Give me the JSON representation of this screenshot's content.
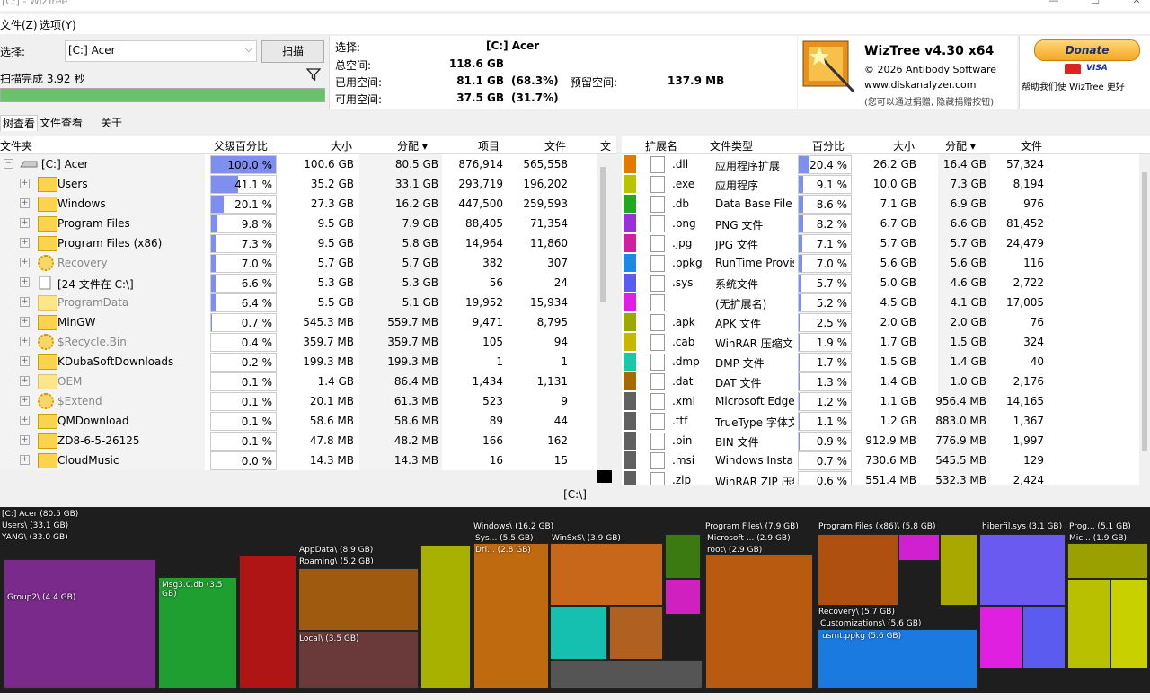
{
  "window": {
    "title": "[C:]  - WizTree"
  },
  "menu": {
    "file": "文件(Z)",
    "options": "选项(Y)"
  },
  "scan": {
    "select_label": "选择:",
    "drive_value": "[C:] Acer",
    "scan_button": "扫描",
    "status": "扫描完成 3.92 秒"
  },
  "drive_info": {
    "select_label": "选择:",
    "select_value": "[C:]  Acer",
    "total_label": "总空间:",
    "total_value": "118.6 GB",
    "used_label": "已用空间:",
    "used_value": "81.1 GB",
    "used_pct": "(68.3%)",
    "free_label": "可用空间:",
    "free_value": "37.5 GB",
    "free_pct": "(31.7%)",
    "reserved_label": "预留空间:",
    "reserved_value": "137.9 MB"
  },
  "about": {
    "product": "WizTree v4.30 x64",
    "copyright": "© 2026 Antibody Software",
    "url": "www.diskanalyzer.com",
    "hint": "(您可以通过捐赠, 隐藏捐赠按钮)"
  },
  "donate": {
    "button": "Donate",
    "visa": "VISA",
    "text": "帮助我们使 WizTree 更好"
  },
  "tabs": [
    "树查看",
    "文件查看",
    "关于"
  ],
  "tree": {
    "columns": [
      "文件夹",
      "父级百分比",
      "大小",
      "分配 ▾",
      "项目",
      "文件",
      "文"
    ],
    "rows": [
      {
        "name": "[C:] Acer",
        "pct": "100.0 %",
        "frac": 1.0,
        "size": "100.6 GB",
        "alloc": "80.5 GB",
        "items": "876,914",
        "files": "565,558",
        "icon": "drive",
        "dim": false
      },
      {
        "name": "Users",
        "pct": "41.1 %",
        "frac": 0.411,
        "size": "35.2 GB",
        "alloc": "33.1 GB",
        "items": "293,719",
        "files": "196,202",
        "icon": "folder",
        "dim": false
      },
      {
        "name": "Windows",
        "pct": "20.1 %",
        "frac": 0.201,
        "size": "27.3 GB",
        "alloc": "16.2 GB",
        "items": "447,500",
        "files": "259,593",
        "icon": "folder",
        "dim": false
      },
      {
        "name": "Program Files",
        "pct": "9.8 %",
        "frac": 0.098,
        "size": "9.5 GB",
        "alloc": "7.9 GB",
        "items": "88,405",
        "files": "71,354",
        "icon": "folder",
        "dim": false
      },
      {
        "name": "Program Files (x86)",
        "pct": "7.3 %",
        "frac": 0.073,
        "size": "9.5 GB",
        "alloc": "5.8 GB",
        "items": "14,964",
        "files": "11,860",
        "icon": "folder",
        "dim": false
      },
      {
        "name": "Recovery",
        "pct": "7.0 %",
        "frac": 0.07,
        "size": "5.7 GB",
        "alloc": "5.7 GB",
        "items": "382",
        "files": "307",
        "icon": "gear",
        "dim": true
      },
      {
        "name": "[24 文件在 C:\\]",
        "pct": "6.6 %",
        "frac": 0.066,
        "size": "5.3 GB",
        "alloc": "5.3 GB",
        "items": "56",
        "files": "24",
        "icon": "files",
        "dim": false
      },
      {
        "name": "ProgramData",
        "pct": "6.4 %",
        "frac": 0.064,
        "size": "5.5 GB",
        "alloc": "5.1 GB",
        "items": "19,952",
        "files": "15,934",
        "icon": "folder",
        "dim": true
      },
      {
        "name": "MinGW",
        "pct": "0.7 %",
        "frac": 0.007,
        "size": "545.3 MB",
        "alloc": "559.7 MB",
        "items": "9,471",
        "files": "8,795",
        "icon": "folder",
        "dim": false
      },
      {
        "name": "$Recycle.Bin",
        "pct": "0.4 %",
        "frac": 0.004,
        "size": "359.7 MB",
        "alloc": "359.7 MB",
        "items": "105",
        "files": "94",
        "icon": "gear",
        "dim": true
      },
      {
        "name": "KDubaSoftDownloads",
        "pct": "0.2 %",
        "frac": 0.002,
        "size": "199.3 MB",
        "alloc": "199.3 MB",
        "items": "1",
        "files": "1",
        "icon": "folder",
        "dim": false
      },
      {
        "name": "OEM",
        "pct": "0.1 %",
        "frac": 0.001,
        "size": "1.4 GB",
        "alloc": "86.4 MB",
        "items": "1,434",
        "files": "1,131",
        "icon": "folder",
        "dim": true
      },
      {
        "name": "$Extend",
        "pct": "0.1 %",
        "frac": 0.001,
        "size": "20.1 MB",
        "alloc": "61.3 MB",
        "items": "523",
        "files": "9",
        "icon": "gear",
        "dim": true
      },
      {
        "name": "QMDownload",
        "pct": "0.1 %",
        "frac": 0.001,
        "size": "58.6 MB",
        "alloc": "58.6 MB",
        "items": "89",
        "files": "44",
        "icon": "folder",
        "dim": false
      },
      {
        "name": "ZD8-6-5-26125",
        "pct": "0.1 %",
        "frac": 0.001,
        "size": "47.8 MB",
        "alloc": "48.2 MB",
        "items": "166",
        "files": "162",
        "icon": "folder",
        "dim": false
      },
      {
        "name": "CloudMusic",
        "pct": "0.0 %",
        "frac": 0.0,
        "size": "14.3 MB",
        "alloc": "14.3 MB",
        "items": "16",
        "files": "15",
        "icon": "folder",
        "dim": false
      }
    ]
  },
  "ext": {
    "columns": [
      "扩展名",
      "文件类型",
      "百分比",
      "大小",
      "分配 ▾",
      "文件"
    ],
    "rows": [
      {
        "ext": ".dll",
        "type": "应用程序扩展",
        "pct": "20.4 %",
        "frac": 0.204,
        "size": "26.2 GB",
        "alloc": "16.4 GB",
        "files": "57,324",
        "color": "#e07b00"
      },
      {
        "ext": ".exe",
        "type": "应用程序",
        "pct": "9.1 %",
        "frac": 0.091,
        "size": "10.0 GB",
        "alloc": "7.3 GB",
        "files": "8,194",
        "color": "#b8c400"
      },
      {
        "ext": ".db",
        "type": "Data Base File",
        "pct": "8.6 %",
        "frac": 0.086,
        "size": "7.1 GB",
        "alloc": "6.9 GB",
        "files": "976",
        "color": "#22a722"
      },
      {
        "ext": ".png",
        "type": "PNG 文件",
        "pct": "8.2 %",
        "frac": 0.082,
        "size": "6.7 GB",
        "alloc": "6.6 GB",
        "files": "81,452",
        "color": "#9b30d8"
      },
      {
        "ext": ".jpg",
        "type": "JPG 文件",
        "pct": "7.1 %",
        "frac": 0.071,
        "size": "5.7 GB",
        "alloc": "5.7 GB",
        "files": "24,479",
        "color": "#d0209f"
      },
      {
        "ext": ".ppkg",
        "type": "RunTime Provisi",
        "pct": "7.0 %",
        "frac": 0.07,
        "size": "5.6 GB",
        "alloc": "5.6 GB",
        "files": "116",
        "color": "#1e88e5"
      },
      {
        "ext": ".sys",
        "type": "系统文件",
        "pct": "5.7 %",
        "frac": 0.057,
        "size": "5.0 GB",
        "alloc": "4.6 GB",
        "files": "2,722",
        "color": "#5b5bf0"
      },
      {
        "ext": "",
        "type": "(无扩展名)",
        "pct": "5.2 %",
        "frac": 0.052,
        "size": "4.5 GB",
        "alloc": "4.1 GB",
        "files": "17,005",
        "color": "#e020e0"
      },
      {
        "ext": ".apk",
        "type": "APK 文件",
        "pct": "2.5 %",
        "frac": 0.025,
        "size": "2.0 GB",
        "alloc": "2.0 GB",
        "files": "76",
        "color": "#9aa800"
      },
      {
        "ext": ".cab",
        "type": "WinRAR 压缩文",
        "pct": "1.9 %",
        "frac": 0.019,
        "size": "1.7 GB",
        "alloc": "1.5 GB",
        "files": "324",
        "color": "#c6b800"
      },
      {
        "ext": ".dmp",
        "type": "DMP 文件",
        "pct": "1.7 %",
        "frac": 0.017,
        "size": "1.5 GB",
        "alloc": "1.4 GB",
        "files": "40",
        "color": "#18c8a8"
      },
      {
        "ext": ".dat",
        "type": "DAT 文件",
        "pct": "1.3 %",
        "frac": 0.013,
        "size": "1.4 GB",
        "alloc": "1.0 GB",
        "files": "2,176",
        "color": "#a86a00"
      },
      {
        "ext": ".xml",
        "type": "Microsoft Edge I",
        "pct": "1.2 %",
        "frac": 0.012,
        "size": "1.1 GB",
        "alloc": "956.4 MB",
        "files": "14,165",
        "color": "#606060"
      },
      {
        "ext": ".ttf",
        "type": "TrueType 字体文",
        "pct": "1.1 %",
        "frac": 0.011,
        "size": "1.2 GB",
        "alloc": "883.0 MB",
        "files": "1,367",
        "color": "#606060"
      },
      {
        "ext": ".bin",
        "type": "BIN 文件",
        "pct": "0.9 %",
        "frac": 0.009,
        "size": "912.9 MB",
        "alloc": "776.9 MB",
        "files": "1,997",
        "color": "#606060"
      },
      {
        "ext": ".msi",
        "type": "Windows Installe",
        "pct": "0.7 %",
        "frac": 0.007,
        "size": "730.6 MB",
        "alloc": "545.5 MB",
        "files": "129",
        "color": "#606060"
      },
      {
        "ext": ".zip",
        "type": "WinRAR ZIP 压缩",
        "pct": "0.6 %",
        "frac": 0.006,
        "size": "551.4 MB",
        "alloc": "532.3 MB",
        "files": "2,424",
        "color": "#606060"
      }
    ]
  },
  "path": "[C:\\]",
  "treemap_labels": {
    "root": "[C:] Acer (80.5 GB)",
    "users": "Users\\ (33.1 GB)",
    "yang": "YANG\\ (33.0 GB)",
    "group": "Group2\\ (4.4 GB)",
    "msg": "Msg3.0.db (3.5 GB)",
    "appdata": "AppData\\ (8.9 GB)",
    "roaming": "Roaming\\ (5.2 GB)",
    "local": "Local\\ (3.5 GB)",
    "windows": "Windows\\ (16.2 GB)",
    "sys": "Sys... (5.5 GB)",
    "dri": "Dri... (2.8 GB)",
    "winsxs": "WinSxS\\ (3.9 GB)",
    "pf": "Program Files\\ (7.9 GB)",
    "ms": "Microsoft ... (2.9 GB)",
    "rootf": "root\\ (2.9 GB)",
    "pf86": "Program Files (x86)\\ (5.8 GB)",
    "recovery": "Recovery\\ (5.7 GB)",
    "custom": "Customizations\\ (5.6 GB)",
    "usmt": "usmt.ppkg (5.6 GB)",
    "hiber": "hiberfil.sys (3.1 GB)",
    "prog": "Prog... (5.1 GB)",
    "mic": "Mic... (1.9 GB)"
  }
}
